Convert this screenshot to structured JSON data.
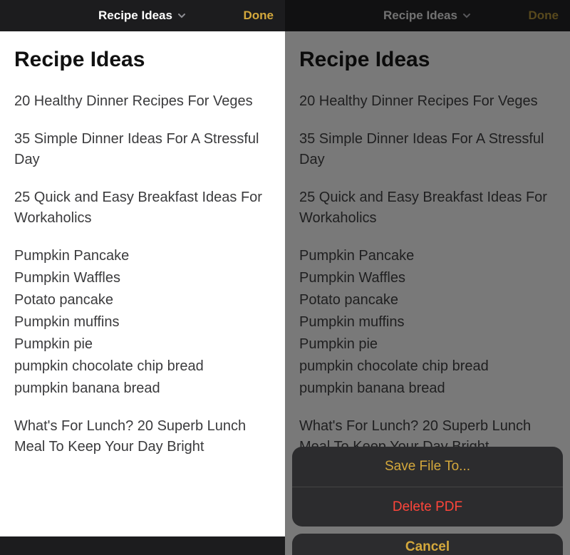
{
  "header": {
    "title": "Recipe Ideas",
    "done_label": "Done"
  },
  "note": {
    "title": "Recipe Ideas",
    "paragraphs": [
      "20 Healthy Dinner Recipes For Veges",
      "35 Simple Dinner Ideas For A Stressful Day",
      "25 Quick and Easy Breakfast Ideas For Workaholics"
    ],
    "list": [
      "Pumpkin Pancake",
      "Pumpkin Waffles",
      "Potato pancake",
      "Pumpkin muffins",
      "Pumpkin pie",
      "pumpkin chocolate chip bread",
      "pumpkin banana bread"
    ],
    "trailing": "What's For Lunch? 20 Superb Lunch Meal To Keep Your Day Bright"
  },
  "action_sheet": {
    "save_label": "Save File To...",
    "delete_label": "Delete PDF",
    "cancel_label": "Cancel"
  }
}
